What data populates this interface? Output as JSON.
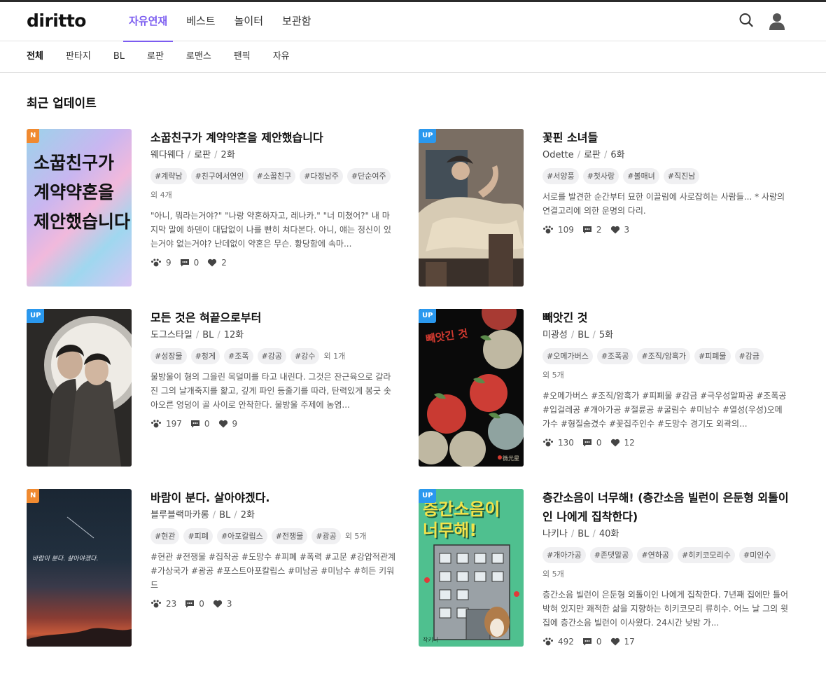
{
  "header": {
    "logo": "diritto",
    "nav": [
      "자유연재",
      "베스트",
      "놀이터",
      "보관함"
    ],
    "active_nav": "자유연재"
  },
  "subnav": [
    "전체",
    "판타지",
    "BL",
    "로판",
    "로맨스",
    "팬픽",
    "자유"
  ],
  "section_title": "최근 업데이트",
  "colors": {
    "accent": "#7b5cf0",
    "badge_n": "#f08a30",
    "badge_up": "#2a98ee"
  },
  "cards": [
    {
      "badge": "N",
      "title": "소꿉친구가 계약약혼을 제안했습니다",
      "author": "웨다웨다",
      "genre": "로판",
      "episodes": "2화",
      "tags": [
        "#계략남",
        "#친구에서연인",
        "#소꿉친구",
        "#다정남주",
        "#단순여주"
      ],
      "more": "외 4개",
      "desc": "\"아니, 뭐라는거야?\" \"나랑 약혼하자고, 레나카.\" \"너 미쳤어?\" 내 마지막 말에 하덴이 대답없이 나를 빤히 쳐다본다. 아니, 얘는 정신이 있는거야 없는거야? 난데없이 약혼은 무슨. 황당함에 속마...",
      "views": "9",
      "comments": "0",
      "likes": "2",
      "cover_text": "소꿉친구가 계약약혼을 제안했습니다"
    },
    {
      "badge": "UP",
      "title": "꽃핀 소녀들",
      "author": "Odette",
      "genre": "로판",
      "episodes": "6화",
      "tags": [
        "#서양풍",
        "#첫사랑",
        "#볼매녀",
        "#직진남"
      ],
      "more": "",
      "desc": "서로를 발견한 순간부터 묘한 이끌림에 사로잡히는 사람들... * 사랑의 연결고리에 의한 운명의 다리.",
      "views": "109",
      "comments": "2",
      "likes": "3"
    },
    {
      "badge": "UP",
      "title": "모든 것은 혀끝으로부터",
      "author": "도그스타일",
      "genre": "BL",
      "episodes": "12화",
      "tags": [
        "#성장물",
        "#청게",
        "#조폭",
        "#강공",
        "#강수"
      ],
      "more": "외 1개",
      "desc": "물방울이 형의 그을린 목덜미를 타고 내린다. 그것은 잔근육으로 갈라진 그의 날개죽지를 핥고, 깊게 파인 등줄기를 따라, 탄력있게 봉긋 솟아오른 엉덩이 골 사이로 안착한다. 물방울 주제에 농염...",
      "views": "197",
      "comments": "0",
      "likes": "9"
    },
    {
      "badge": "UP",
      "title": "빼앗긴 것",
      "author": "미광성",
      "genre": "BL",
      "episodes": "5화",
      "tags": [
        "#오메가버스",
        "#조폭공",
        "#조직/암흑가",
        "#피폐물",
        "#감금"
      ],
      "more": "외 5개",
      "desc": "#오메가버스 #조직/암흑가 #피폐물 #감금 #극우성알파공 #조폭공 #입걸레공 #개아가공 #절륜공 #굴림수 #미남수 #열성(우성)오메가수 #형질숨겼수 #꽃집주인수 #도망수 경기도 외곽의...",
      "views": "130",
      "comments": "0",
      "likes": "12",
      "cover_text": "빼앗긴 것",
      "cover_sign": "微光星"
    },
    {
      "badge": "N",
      "title": "바람이 분다. 살아야겠다.",
      "author": "블루블랙마카롱",
      "genre": "BL",
      "episodes": "2화",
      "tags": [
        "#현관",
        "#피폐",
        "#아포칼립스",
        "#전쟁물",
        "#광공"
      ],
      "more": "외 5개",
      "desc": "#현관 #전쟁물 #집착공 #도망수 #피폐 #폭력 #고문 #강압적관계 #가상국가 #광공 #포스트아포칼립스 #미남공 #미남수 #히든 키워드 ===================================...",
      "views": "23",
      "comments": "0",
      "likes": "3",
      "cover_text": "바람이 분다. 살아야겠다."
    },
    {
      "badge": "UP",
      "title": "층간소음이 너무해! (층간소음 빌런이 은둔형 외톨이인 나에게 집착한다)",
      "author": "나키나",
      "genre": "BL",
      "episodes": "40화",
      "tags": [
        "#개아가공",
        "#존댓말공",
        "#연하공",
        "#히키코모리수",
        "#미인수"
      ],
      "more": "외 5개",
      "desc": "층간소음 빌런이 은둔형 외톨이인 나에게 집착한다. 7년째 집에만 틀어박혀 있지만 쾌적한 삶을 지향하는 히키코모리 류히수. 어느 날 그의 윗집에 층간소음 빌런이 이사왔다. 24시간 낮밤 가...",
      "views": "492",
      "comments": "0",
      "likes": "17",
      "cover_text": "층간소음이 너무해!",
      "cover_sign": "작키나"
    }
  ]
}
